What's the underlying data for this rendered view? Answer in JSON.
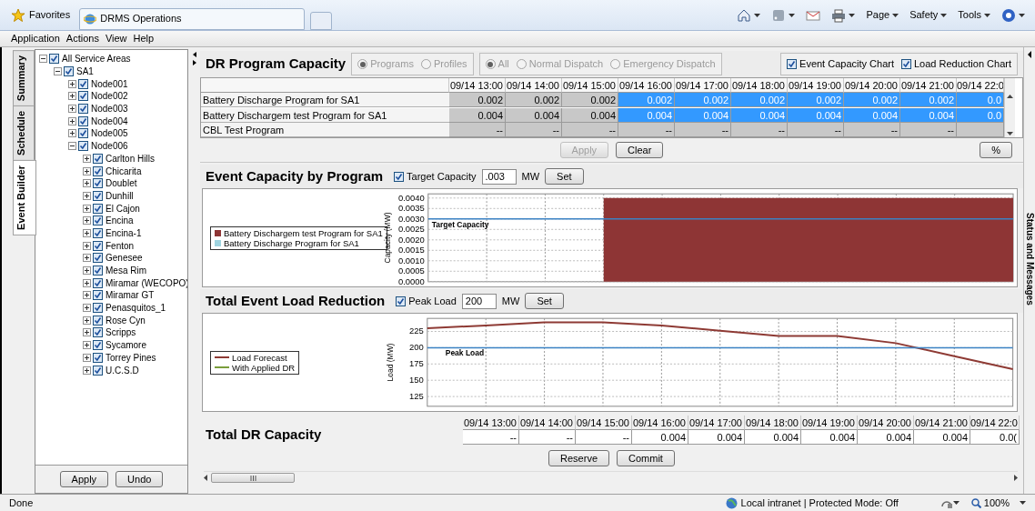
{
  "browser": {
    "favorites": "Favorites",
    "tab_title": "DRMS Operations",
    "commands": [
      "Page",
      "Safety",
      "Tools"
    ]
  },
  "menu": [
    "Application",
    "Actions",
    "View",
    "Help"
  ],
  "side_tabs": [
    {
      "label": "Summary",
      "selected": false
    },
    {
      "label": "Schedule",
      "selected": false
    },
    {
      "label": "Event Builder",
      "selected": true
    }
  ],
  "tree": [
    {
      "label": "All Service Areas",
      "checked": true,
      "expanded": true,
      "children": [
        {
          "label": "SA1",
          "checked": true,
          "expanded": true,
          "children": [
            {
              "label": "Node001",
              "checked": true,
              "expanded": false
            },
            {
              "label": "Node002",
              "checked": true,
              "expanded": false
            },
            {
              "label": "Node003",
              "checked": true,
              "expanded": false
            },
            {
              "label": "Node004",
              "checked": true,
              "expanded": false
            },
            {
              "label": "Node005",
              "checked": true,
              "expanded": false
            },
            {
              "label": "Node006",
              "checked": true,
              "expanded": true,
              "children": [
                {
                  "label": "Carlton Hills",
                  "checked": true,
                  "expanded": false
                },
                {
                  "label": "Chicarita",
                  "checked": true,
                  "expanded": false
                },
                {
                  "label": "Doublet",
                  "checked": true,
                  "expanded": false
                },
                {
                  "label": "Dunhill",
                  "checked": true,
                  "expanded": false
                },
                {
                  "label": "El Cajon",
                  "checked": true,
                  "expanded": false
                },
                {
                  "label": "Encina",
                  "checked": true,
                  "expanded": false
                },
                {
                  "label": "Encina-1",
                  "checked": true,
                  "expanded": false
                },
                {
                  "label": "Fenton",
                  "checked": true,
                  "expanded": false
                },
                {
                  "label": "Genesee",
                  "checked": true,
                  "expanded": false
                },
                {
                  "label": "Mesa Rim",
                  "checked": true,
                  "expanded": false
                },
                {
                  "label": "Miramar (WECOPO)",
                  "checked": true,
                  "expanded": false
                },
                {
                  "label": "Miramar GT",
                  "checked": true,
                  "expanded": false
                },
                {
                  "label": "Penasquitos_1",
                  "checked": true,
                  "expanded": false
                },
                {
                  "label": "Rose Cyn",
                  "checked": true,
                  "expanded": false
                },
                {
                  "label": "Scripps",
                  "checked": true,
                  "expanded": false
                },
                {
                  "label": "Sycamore",
                  "checked": true,
                  "expanded": false
                },
                {
                  "label": "Torrey Pines",
                  "checked": true,
                  "expanded": false
                },
                {
                  "label": "U.C.S.D",
                  "checked": true,
                  "expanded": false
                }
              ]
            }
          ]
        }
      ]
    }
  ],
  "tree_buttons": [
    "Apply",
    "Undo"
  ],
  "program_capacity": {
    "title": "DR Program Capacity",
    "view_options": [
      {
        "label": "Programs",
        "selected": true,
        "disabled": true
      },
      {
        "label": "Profiles",
        "selected": false,
        "disabled": true
      }
    ],
    "dispatch_options": [
      {
        "label": "All",
        "selected": true,
        "disabled": true
      },
      {
        "label": "Normal Dispatch",
        "selected": false,
        "disabled": true
      },
      {
        "label": "Emergency Dispatch",
        "selected": false,
        "disabled": true
      }
    ],
    "chart_toggles": [
      {
        "label": "Event Capacity Chart",
        "checked": true
      },
      {
        "label": "Load Reduction Chart",
        "checked": true
      }
    ],
    "columns": [
      "09/14 13:00",
      "09/14 14:00",
      "09/14 15:00",
      "09/14 16:00",
      "09/14 17:00",
      "09/14 18:00",
      "09/14 19:00",
      "09/14 20:00",
      "09/14 21:00",
      "09/14 22:0"
    ],
    "rows": [
      {
        "label": "Battery Discharge Program for SA1",
        "cells": [
          {
            "text": "0.002",
            "selected": false
          },
          {
            "text": "0.002",
            "selected": false
          },
          {
            "text": "0.002",
            "selected": false
          },
          {
            "text": "0.002",
            "selected": true
          },
          {
            "text": "0.002",
            "selected": true
          },
          {
            "text": "0.002",
            "selected": true
          },
          {
            "text": "0.002",
            "selected": true
          },
          {
            "text": "0.002",
            "selected": true
          },
          {
            "text": "0.002",
            "selected": true
          },
          {
            "text": "0.0",
            "selected": true
          }
        ]
      },
      {
        "label": "Battery Dischargem test Program for SA1",
        "cells": [
          {
            "text": "0.004",
            "selected": false
          },
          {
            "text": "0.004",
            "selected": false
          },
          {
            "text": "0.004",
            "selected": false
          },
          {
            "text": "0.004",
            "selected": true
          },
          {
            "text": "0.004",
            "selected": true
          },
          {
            "text": "0.004",
            "selected": true
          },
          {
            "text": "0.004",
            "selected": true
          },
          {
            "text": "0.004",
            "selected": true
          },
          {
            "text": "0.004",
            "selected": true
          },
          {
            "text": "0.0",
            "selected": true
          }
        ]
      },
      {
        "label": "CBL Test Program",
        "cells": [
          {
            "text": "--",
            "selected": false
          },
          {
            "text": "--",
            "selected": false
          },
          {
            "text": "--",
            "selected": false
          },
          {
            "text": "--",
            "selected": false
          },
          {
            "text": "--",
            "selected": false
          },
          {
            "text": "--",
            "selected": false
          },
          {
            "text": "--",
            "selected": false
          },
          {
            "text": "--",
            "selected": false
          },
          {
            "text": "--",
            "selected": false
          }
        ]
      }
    ],
    "buttons": [
      {
        "label": "Apply",
        "disabled": true
      },
      {
        "label": "Clear",
        "disabled": false
      }
    ],
    "percent_button": "%"
  },
  "event_capacity": {
    "title": "Event Capacity by Program",
    "toggle": {
      "label": "Target Capacity",
      "checked": true
    },
    "value": ".003",
    "unit": "MW",
    "button": "Set",
    "chart_data": {
      "type": "area",
      "ylabel": "Capacity (MW)",
      "categories": [
        null,
        null,
        null,
        null,
        null,
        null,
        null,
        null,
        null,
        null,
        null
      ],
      "ylim": [
        0,
        0.0042
      ],
      "grid": true,
      "yticks": [
        {
          "value": 0,
          "label": "0.0000"
        },
        {
          "value": 0.0005,
          "label": "0.0005"
        },
        {
          "value": 0.001,
          "label": "0.0010"
        },
        {
          "value": 0.0015,
          "label": "0.0015"
        },
        {
          "value": 0.002,
          "label": "0.0020"
        },
        {
          "value": 0.0025,
          "label": "0.0025"
        },
        {
          "value": 0.003,
          "label": "0.0030"
        },
        {
          "value": 0.0035,
          "label": "0.0035"
        },
        {
          "value": 0.004,
          "label": "0.0040"
        }
      ],
      "series": [
        {
          "name": "Battery Dischargem test Program for SA1",
          "color": "#8e3535",
          "values": [
            null,
            null,
            null,
            0.004,
            0.004,
            0.004,
            0.004,
            0.004,
            0.004,
            0.004,
            0.004
          ]
        },
        {
          "name": "Battery Discharge Program for SA1",
          "color": "#9ed3df",
          "values": [
            null,
            null,
            null,
            null,
            null,
            null,
            null,
            null,
            null,
            null,
            null
          ]
        },
        {
          "name": "Target Capacity",
          "type": "line",
          "color": "#3b82c4",
          "values": [
            0.003,
            0.003,
            0.003,
            0.003,
            0.003,
            0.003,
            0.003,
            0.003,
            0.003,
            0.003,
            0.003
          ]
        }
      ]
    }
  },
  "load_reduction": {
    "title": "Total Event Load Reduction",
    "toggle": {
      "label": "Peak Load",
      "checked": true
    },
    "value": "200",
    "unit": "MW",
    "button": "Set",
    "chart_data": {
      "type": "line",
      "ylabel": "Load (MW)",
      "categories": [
        null,
        null,
        null,
        null,
        null,
        null,
        null,
        null,
        null,
        null,
        null
      ],
      "ylim": [
        110,
        245
      ],
      "grid": true,
      "yticks": [
        125,
        150,
        175,
        200,
        225
      ],
      "series": [
        {
          "name": "Load Forecast",
          "color": "#8e3a34",
          "values": [
            230,
            234,
            239,
            239,
            234,
            226,
            218,
            218,
            207,
            187,
            167
          ]
        },
        {
          "name": "With Applied DR",
          "color": "#7a9e3c",
          "values": [
            null,
            null,
            null,
            null,
            null,
            null,
            null,
            null,
            null,
            null,
            null
          ]
        },
        {
          "name": "Peak Load",
          "type": "line",
          "color": "#3b82c4",
          "values": [
            200,
            200,
            200,
            200,
            200,
            200,
            200,
            200,
            200,
            200,
            200
          ]
        }
      ]
    }
  },
  "total_capacity": {
    "title": "Total DR Capacity",
    "columns": [
      "09/14 13:00",
      "09/14 14:00",
      "09/14 15:00",
      "09/14 16:00",
      "09/14 17:00",
      "09/14 18:00",
      "09/14 19:00",
      "09/14 20:00",
      "09/14 21:00",
      "09/14 22:0"
    ],
    "values": [
      "--",
      "--",
      "--",
      "0.004",
      "0.004",
      "0.004",
      "0.004",
      "0.004",
      "0.004",
      "0.0("
    ],
    "buttons": [
      "Reserve",
      "Commit"
    ]
  },
  "side_panel": "Status and Messages",
  "status_bar": {
    "text": "Done",
    "zone": "Local intranet | Protected Mode: Off",
    "zoom": "100%"
  }
}
